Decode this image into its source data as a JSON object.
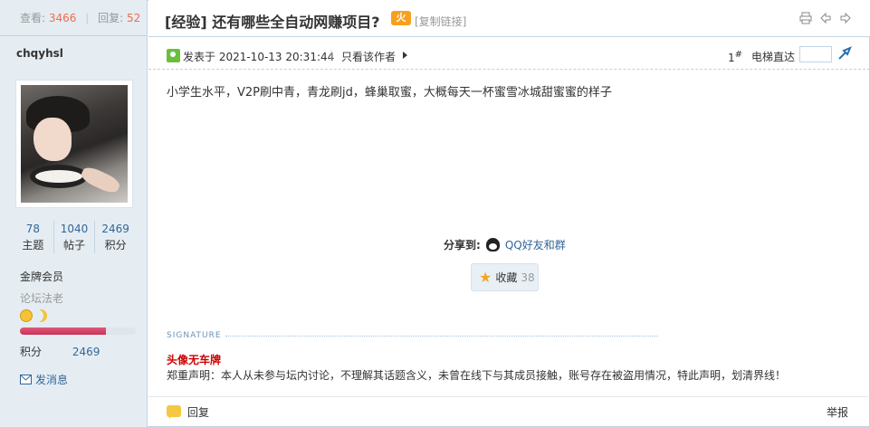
{
  "stats": {
    "views_label": "查看:",
    "views": "3466",
    "replies_label": "回复:",
    "replies": "52"
  },
  "user": {
    "name": "chqyhsl",
    "counts": [
      {
        "value": "78",
        "label": "主题"
      },
      {
        "value": "1040",
        "label": "帖子"
      },
      {
        "value": "2469",
        "label": "积分"
      }
    ],
    "rank": "金牌会员",
    "title": "论坛法老",
    "level_progress": 0.74,
    "credit_label": "积分",
    "credit_value": "2469",
    "pm_label": "发消息"
  },
  "thread": {
    "title": "[经验] 还有哪些全自动网赚项目?",
    "hot_badge": "火",
    "copy_link": "[复制链接]"
  },
  "post": {
    "posted_at": "发表于 2021-10-13 20:31:44",
    "separator": "|",
    "author_only": "只看该作者",
    "floor": "1",
    "floor_suffix": "#",
    "elevator_label": "电梯直达",
    "content": "小学生水平，V2P刷中青，青龙刷jd，蜂巢取蜜，大概每天一杯蜜雪冰城甜蜜蜜的样子",
    "share_label": "分享到:",
    "share_qq": "QQ好友和群",
    "fav_label": "收藏",
    "fav_count": "38",
    "signature_label": "SIGNATURE",
    "signature_name": "头像无车牌",
    "signature_text": "郑重声明：本人从未参与坛内讨论，不理解其话题含义，未曾在线下与其成员接触，账号存在被盗用情况，特此声明，划清界线！",
    "reply": "回复",
    "report": "举报"
  },
  "colors": {
    "accent_blue": "#336699",
    "highlight_orange": "#f26c4f",
    "signature_red": "#cc0000",
    "side_bg": "#e5edf2"
  },
  "icons": [
    "print-icon",
    "prev-thread-icon",
    "next-thread-icon",
    "online-status-icon",
    "qq-icon",
    "star-icon",
    "message-icon",
    "reply-icon",
    "elevator-go-icon"
  ]
}
